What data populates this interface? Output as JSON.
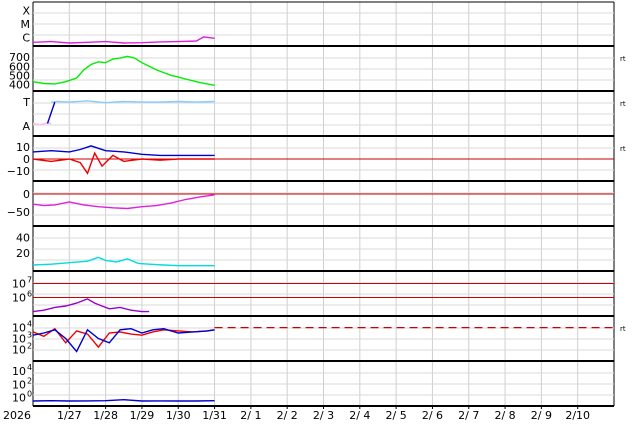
{
  "chart_data": {
    "type": "line",
    "x_start_date": "2026-01-26",
    "days": 16,
    "year_label": "2026",
    "x_tick_labels": [
      "1/27",
      "1/28",
      "1/29",
      "1/30",
      "1/31",
      "2/ 1",
      "2/ 2",
      "2/ 3",
      "2/ 4",
      "2/ 5",
      "2/ 6",
      "2/ 7",
      "2/ 8",
      "2/ 9",
      "2/10"
    ],
    "right_label": "rt",
    "data_end_day": 5.0,
    "colors": {
      "magenta": "#dd22dd",
      "green": "#00ee00",
      "lightblue": "#88ccff",
      "pink": "#ffbbee",
      "blue": "#0000cc",
      "red": "#ee0000",
      "cyan": "#00dddd",
      "purple": "#9900cc",
      "refline": "#cc0000"
    },
    "panels": [
      {
        "id": "xray_class",
        "tick_labels": [
          {
            "text": "X",
            "v": 2
          },
          {
            "text": "M",
            "v": 1
          },
          {
            "text": "C",
            "v": 0
          }
        ],
        "ylim": [
          -0.4,
          2.4
        ],
        "series": [
          {
            "color": "magenta",
            "x": [
              0,
              0.5,
              1,
              1.5,
              2,
              2.5,
              3,
              3.5,
              4,
              4.5,
              4.7,
              5
            ],
            "y": [
              -0.35,
              -0.3,
              -0.4,
              -0.35,
              -0.3,
              -0.4,
              -0.38,
              -0.32,
              -0.3,
              -0.25,
              0.05,
              -0.05
            ]
          }
        ]
      },
      {
        "id": "solar_wind_speed",
        "right_label": true,
        "tick_labels": [
          {
            "text": "700",
            "v": 700
          },
          {
            "text": "600",
            "v": 600
          },
          {
            "text": "500",
            "v": 500
          },
          {
            "text": "400",
            "v": 400
          }
        ],
        "ylim": [
          360,
          780
        ],
        "series": [
          {
            "color": "green",
            "x": [
              0,
              0.3,
              0.6,
              0.9,
              1.2,
              1.4,
              1.6,
              1.8,
              2.0,
              2.2,
              2.4,
              2.6,
              2.8,
              3.0,
              3.2,
              3.4,
              3.6,
              3.8,
              4.0,
              4.2,
              4.4,
              4.6,
              4.8,
              5.0
            ],
            "y": [
              430,
              410,
              405,
              430,
              470,
              560,
              620,
              650,
              640,
              680,
              690,
              710,
              690,
              640,
              600,
              560,
              530,
              500,
              480,
              460,
              440,
              420,
              405,
              390
            ]
          }
        ]
      },
      {
        "id": "imf_direction",
        "right_label": true,
        "tick_labels": [
          {
            "text": "T",
            "v": 1
          },
          {
            "text": "A",
            "v": -1
          }
        ],
        "ylim": [
          -1.6,
          1.6
        ],
        "series": [
          {
            "color": "pink",
            "x": [
              0,
              0.2,
              0.4,
              0.5
            ],
            "y": [
              -0.8,
              -0.9,
              -0.75,
              -0.8
            ]
          },
          {
            "color": "lightblue",
            "x": [
              0.5,
              0.7,
              1.0,
              1.5,
              2.0,
              2.5,
              3.0,
              3.5,
              4.0,
              4.5,
              5.0
            ],
            "y": [
              1.0,
              1.05,
              1.0,
              1.1,
              0.95,
              1.05,
              1.0,
              1.0,
              1.05,
              1.0,
              1.05
            ]
          },
          {
            "color": "blue",
            "x": [
              0.4,
              0.6
            ],
            "y": [
              -0.8,
              1.0
            ]
          }
        ]
      },
      {
        "id": "imf_bt_bz",
        "right_label": true,
        "tick_labels": [
          {
            "text": "10",
            "v": 10
          },
          {
            "text": "0",
            "v": 0
          },
          {
            "text": "−10",
            "v": -10
          }
        ],
        "ylim": [
          -16,
          16
        ],
        "ref_lines": [
          0
        ],
        "series": [
          {
            "color": "blue",
            "x": [
              0,
              0.5,
              1,
              1.3,
              1.6,
              2.0,
              2.5,
              3.0,
              3.5,
              4.0,
              4.5,
              5.0
            ],
            "y": [
              6,
              7,
              6,
              8,
              11,
              7,
              6,
              4,
              3,
              3,
              3,
              3
            ]
          },
          {
            "color": "red",
            "x": [
              0,
              0.5,
              1,
              1.3,
              1.5,
              1.7,
              1.9,
              2.2,
              2.5,
              3.0,
              3.5,
              4.0,
              4.5,
              5.0
            ],
            "y": [
              0,
              -2,
              0,
              -3,
              -12,
              5,
              -6,
              3,
              -2,
              0,
              -1,
              0,
              0,
              0
            ]
          }
        ]
      },
      {
        "id": "dst",
        "tick_labels": [
          {
            "text": "0",
            "v": 0
          },
          {
            "text": "−50",
            "v": -50
          }
        ],
        "ylim": [
          -80,
          25
        ],
        "ref_lines": [
          0
        ],
        "series": [
          {
            "color": "magenta",
            "x": [
              0,
              0.3,
              0.6,
              1.0,
              1.4,
              1.8,
              2.2,
              2.6,
              3.0,
              3.4,
              3.8,
              4.2,
              4.6,
              5.0
            ],
            "y": [
              -28,
              -32,
              -30,
              -22,
              -30,
              -35,
              -38,
              -40,
              -35,
              -32,
              -25,
              -15,
              -8,
              -2
            ]
          }
        ]
      },
      {
        "id": "proton_density",
        "tick_labels": [
          {
            "text": "40",
            "v": 40
          },
          {
            "text": "20",
            "v": 20
          }
        ],
        "ylim": [
          0,
          50
        ],
        "series": [
          {
            "color": "cyan",
            "x": [
              0,
              0.5,
              1.0,
              1.5,
              1.8,
              2.0,
              2.3,
              2.6,
              2.9,
              3.2,
              3.6,
              4.0,
              4.5,
              5.0
            ],
            "y": [
              4,
              5,
              7,
              9,
              14,
              10,
              8,
              12,
              6,
              5,
              4,
              3,
              3,
              3
            ]
          }
        ]
      },
      {
        "id": "proton_flux",
        "tick_labels": [
          {
            "text": "10",
            "sup": "7",
            "v": 7
          },
          {
            "text": "10",
            "sup": "6",
            "v": 6
          }
        ],
        "ylim": [
          4.9,
          7.6
        ],
        "ref_lines": [
          7,
          6
        ],
        "series": [
          {
            "color": "purple",
            "x": [
              0,
              0.3,
              0.6,
              0.9,
              1.2,
              1.5,
              1.7,
              1.9,
              2.1,
              2.4,
              2.7,
              3.0,
              3.2
            ],
            "y": [
              5.0,
              5.1,
              5.3,
              5.4,
              5.6,
              5.9,
              5.6,
              5.4,
              5.2,
              5.3,
              5.1,
              5.0,
              5.0
            ]
          }
        ]
      },
      {
        "id": "electron_flux",
        "right_label": true,
        "tick_labels": [
          {
            "text": "10",
            "sup": "4",
            "v": 4
          },
          {
            "text": "10",
            "sup": "3",
            "v": 3
          },
          {
            "text": "10",
            "sup": "2",
            "v": 2
          }
        ],
        "ylim": [
          1.2,
          4.7
        ],
        "dashed_ref": 4,
        "series": [
          {
            "color": "red",
            "x": [
              0,
              0.3,
              0.6,
              0.9,
              1.2,
              1.5,
              1.8,
              2.1,
              2.4,
              2.7,
              3.0,
              3.3,
              3.6,
              4.0,
              4.4,
              4.8,
              5.0
            ],
            "y": [
              3.6,
              3.2,
              3.9,
              2.6,
              3.7,
              3.4,
              2.2,
              3.5,
              3.6,
              3.4,
              3.3,
              3.6,
              3.8,
              3.7,
              3.6,
              3.7,
              3.8
            ]
          },
          {
            "color": "blue",
            "x": [
              0,
              0.3,
              0.6,
              0.9,
              1.2,
              1.5,
              1.8,
              2.1,
              2.4,
              2.7,
              3.0,
              3.3,
              3.6,
              4.0,
              4.4,
              4.8,
              5.0
            ],
            "y": [
              3.3,
              3.5,
              3.8,
              3.0,
              1.8,
              3.8,
              3.0,
              2.6,
              3.8,
              3.9,
              3.5,
              3.8,
              3.9,
              3.5,
              3.6,
              3.7,
              3.8
            ]
          }
        ]
      },
      {
        "id": "electron_flux_low",
        "tick_labels": [
          {
            "text": "10",
            "sup": "4",
            "v": 4
          },
          {
            "text": "10",
            "sup": "2",
            "v": 2
          },
          {
            "text": "10",
            "sup": "0",
            "v": 0
          }
        ],
        "ylim": [
          -0.8,
          4.9
        ],
        "series": [
          {
            "color": "blue",
            "x": [
              0,
              0.5,
              1.0,
              1.5,
              2.0,
              2.5,
              3.0,
              3.5,
              4.0,
              4.5,
              5.0
            ],
            "y": [
              -0.5,
              -0.45,
              -0.5,
              -0.48,
              -0.45,
              -0.3,
              -0.5,
              -0.48,
              -0.5,
              -0.5,
              -0.45
            ]
          }
        ]
      }
    ]
  }
}
